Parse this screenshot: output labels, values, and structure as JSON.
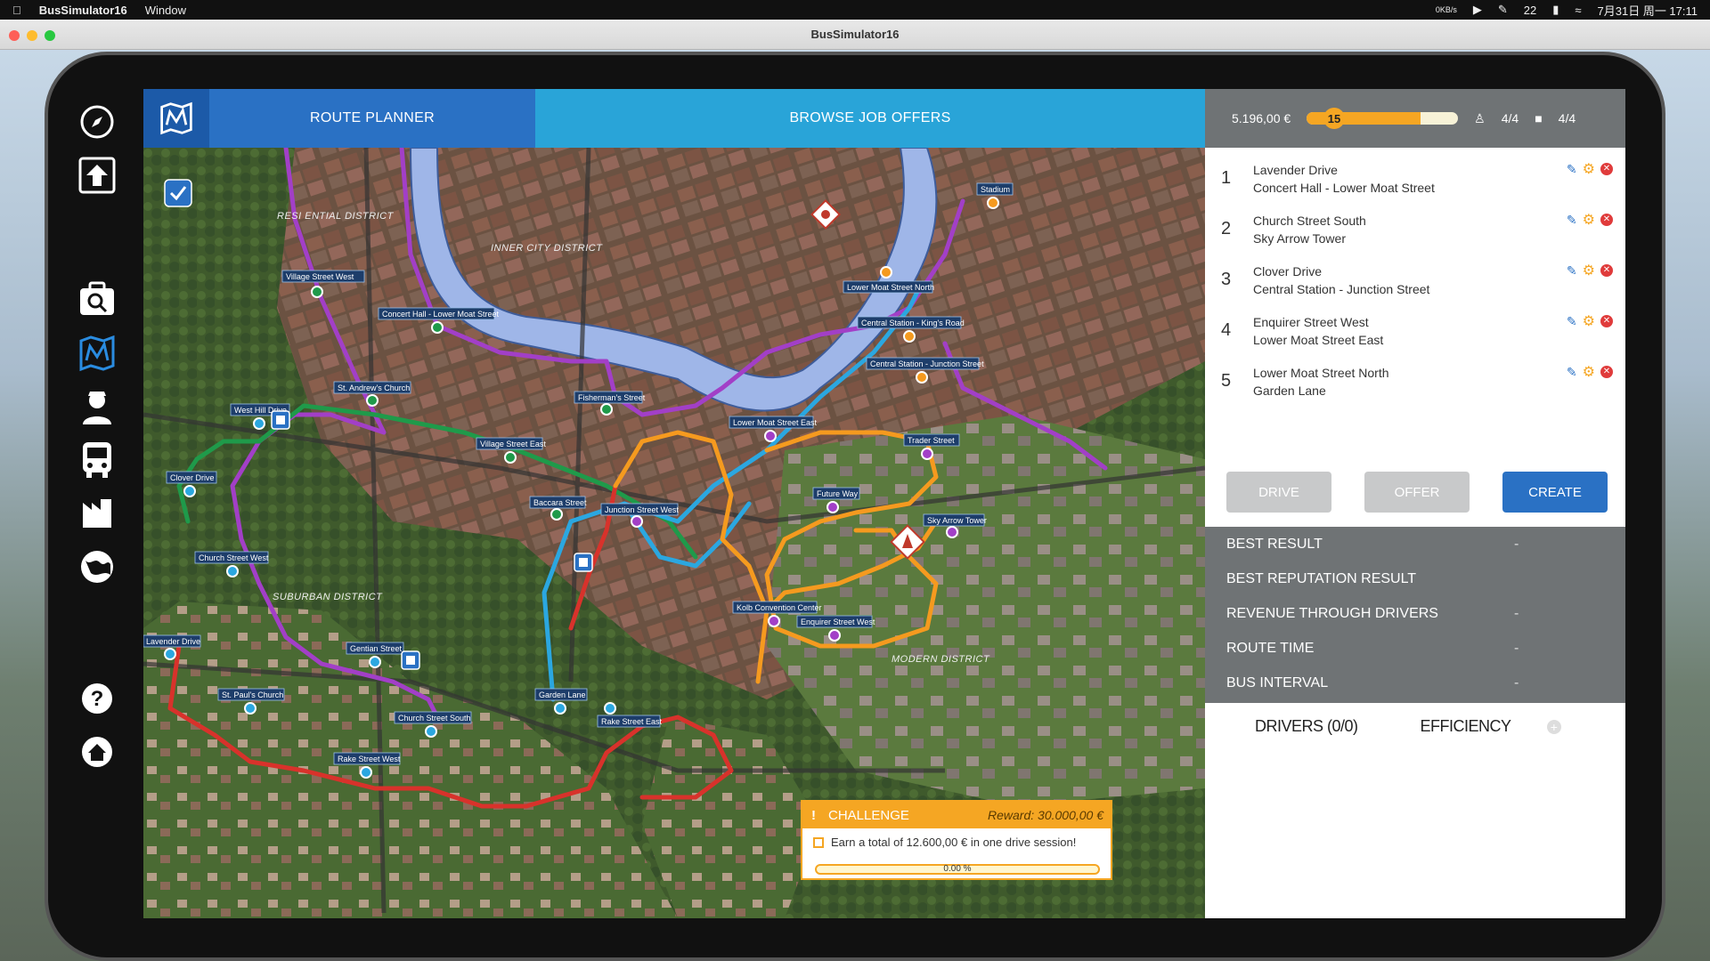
{
  "menubar": {
    "app": "BusSimulator16",
    "menu": "Window",
    "net": "0KB/s",
    "wechat": "22",
    "datetime": "7月31日 周一  17:11"
  },
  "window": {
    "title": "BusSimulator16"
  },
  "tabs": {
    "route_planner": "ROUTE PLANNER",
    "browse_jobs": "BROWSE JOB OFFERS"
  },
  "stats": {
    "money": "5.196,00 €",
    "level": "15",
    "level_progress": 0.75,
    "drivers": "4/4",
    "buses": "4/4"
  },
  "routes": [
    {
      "num": "1",
      "line1": "Lavender Drive",
      "line2": "Concert Hall - Lower Moat Street"
    },
    {
      "num": "2",
      "line1": "Church Street South",
      "line2": "Sky Arrow Tower"
    },
    {
      "num": "3",
      "line1": "Clover Drive",
      "line2": "Central Station - Junction Street"
    },
    {
      "num": "4",
      "line1": "Enquirer Street West",
      "line2": "Lower Moat Street East"
    },
    {
      "num": "5",
      "line1": "Lower Moat Street North",
      "line2": "Garden Lane"
    }
  ],
  "buttons": {
    "drive": "DRIVE",
    "offer": "OFFER",
    "create": "CREATE"
  },
  "results": [
    {
      "label": "BEST RESULT",
      "value": "-"
    },
    {
      "label": "BEST REPUTATION RESULT",
      "value": ""
    },
    {
      "label": "REVENUE THROUGH DRIVERS",
      "value": "-"
    },
    {
      "label": "ROUTE TIME",
      "value": "-"
    },
    {
      "label": "BUS INTERVAL",
      "value": "-"
    }
  ],
  "drivers_tab": {
    "drivers": "DRIVERS (0/0)",
    "efficiency": "EFFICIENCY"
  },
  "challenge": {
    "title": "CHALLENGE",
    "reward": "Reward: 30.000,00 €",
    "task": "Earn a total of 12.600,00 € in one drive session!",
    "progress": "0.00 %"
  },
  "map": {
    "districts": [
      "RESI ENTIAL DISTRICT",
      "INNER CITY DISTRICT",
      "SUBURBAN DISTRICT",
      "MODERN DISTRICT"
    ],
    "stops": [
      "Village Street West",
      "Concert Hall - Lower Moat Street",
      "St. Andrew's Church",
      "West Hill Drive",
      "Clover Drive",
      "Church Street West",
      "Lavender Drive",
      "St. Paul's Church",
      "Gentian Street",
      "Church Street South",
      "Rake Street West",
      "Garden Lane",
      "Rake Street East",
      "Village Street East",
      "Fisherman's Street",
      "Baccara Street",
      "Junction Street West",
      "Lower Moat Street East",
      "Lower Moat Street North",
      "Central Station - King's Road",
      "Central Station - Junction Street",
      "Stadium",
      "Trader Street",
      "Future Way",
      "Sky Arrow Tower",
      "Kolb Convention Center",
      "Enquirer Street West"
    ]
  },
  "colors": {
    "accent": "#2a71c4",
    "tab_inactive": "#29a4d8",
    "orange": "#f5a623",
    "route_purple": "#a23fc7",
    "route_green": "#1f9a4a",
    "route_red": "#d8322b",
    "route_blue": "#2ba7e0",
    "route_orange": "#f59a1f"
  }
}
